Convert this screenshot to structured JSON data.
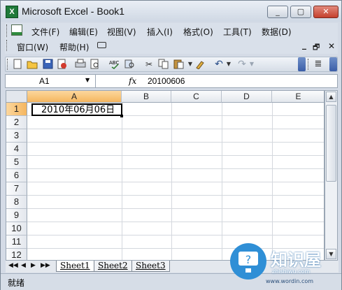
{
  "window": {
    "app_icon_letter": "X",
    "title": "Microsoft Excel - Book1",
    "controls": [
      "_",
      "▢",
      "✕"
    ]
  },
  "menu": {
    "row1": [
      "文件(F)",
      "编辑(E)",
      "视图(V)",
      "插入(I)",
      "格式(O)",
      "工具(T)",
      "数据(D)"
    ],
    "row2": [
      "窗口(W)",
      "帮助(H)"
    ],
    "doc_controls": [
      "_",
      "🗗",
      "✕"
    ]
  },
  "toolbar": {
    "icons": [
      "new-icon",
      "open-icon",
      "save-icon",
      "permission-icon",
      "print-icon",
      "print-preview-icon",
      "spelling-icon",
      "research-icon",
      "cut-icon",
      "copy-icon",
      "paste-icon",
      "format-painter-icon",
      "undo-icon",
      "redo-icon"
    ]
  },
  "formula_bar": {
    "name_box": "A1",
    "fx_label": "fx",
    "value": "20100606"
  },
  "grid": {
    "columns": [
      "A",
      "B",
      "C",
      "D",
      "E"
    ],
    "rows": [
      "1",
      "2",
      "3",
      "4",
      "5",
      "6",
      "7",
      "8",
      "9",
      "10",
      "11",
      "12"
    ],
    "cell_A1": "2010年06月06日"
  },
  "sheets": {
    "nav": [
      "◀◀",
      "◀",
      "▶",
      "▶▶"
    ],
    "tabs": [
      "Sheet1",
      "Sheet2",
      "Sheet3"
    ]
  },
  "status": {
    "text": "就绪"
  },
  "watermark": {
    "brand": "知识屋",
    "site1": "zhishiwu.com",
    "site2": "www.wordin.com"
  }
}
